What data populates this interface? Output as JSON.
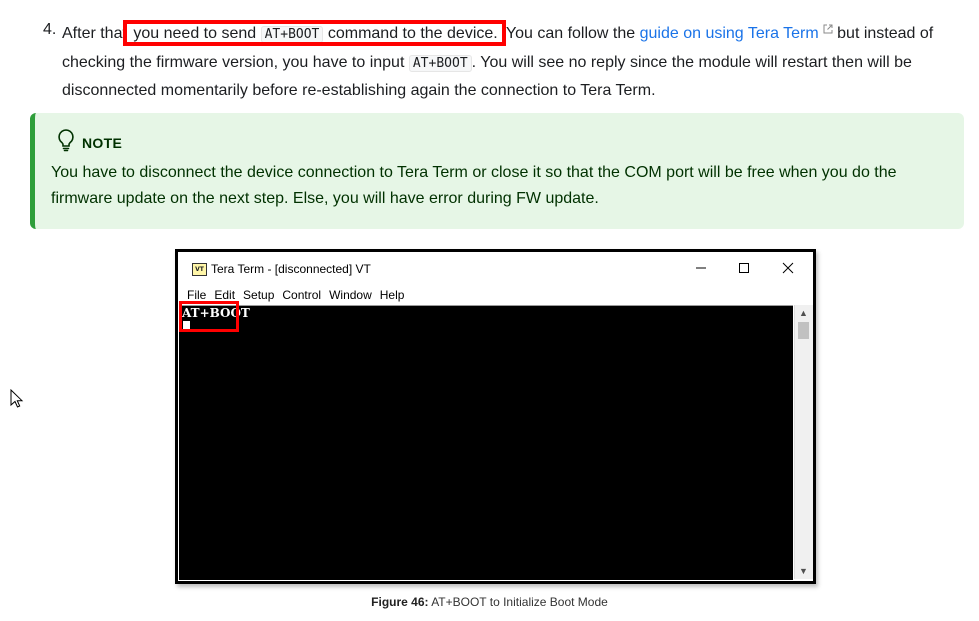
{
  "step": {
    "number": "4.",
    "before_highlight": "After that",
    "highlight_before_code": "you need to send",
    "code_1": "AT+BOOT",
    "highlight_after_code": "command to the device.",
    "after_highlight": "You can follow the",
    "link_text": "guide on using Tera Term",
    "after_link": "but instead of checking the firmware version, you have to input",
    "code_2": "AT+BOOT",
    "ending": ". You will see no reply since the module will restart then will be disconnected momentarily before re-establishing again the connection to Tera Term."
  },
  "note": {
    "icon": "lightbulb-icon",
    "title": "NOTE",
    "body": "You have to disconnect the device connection to Tera Term or close it so that the COM port will be free when you do the firmware update on the next step. Else, you will have error during FW update."
  },
  "teraterm": {
    "icon_label": "VT",
    "title": "Tera Term - [disconnected] VT",
    "menu": [
      "File",
      "Edit",
      "Setup",
      "Control",
      "Window",
      "Help"
    ],
    "terminal_text": "AT+BOOT"
  },
  "caption": {
    "label": "Figure 46:",
    "text": "AT+BOOT to Initialize Boot Mode"
  },
  "colors": {
    "link": "#1a73e8",
    "note_bg": "#e6f6e6",
    "note_border": "#2e9e3a",
    "highlight": "#ff0000"
  }
}
